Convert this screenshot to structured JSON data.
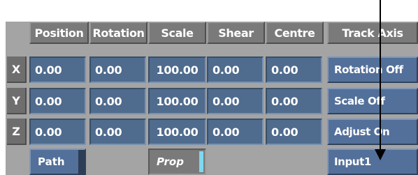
{
  "headers": {
    "position": "Position",
    "rotation": "Rotation",
    "scale": "Scale",
    "shear": "Shear",
    "centre": "Centre",
    "track_axis": "Track Axis"
  },
  "rows": [
    {
      "label": "X",
      "position": "0.00",
      "rotation": "0.00",
      "scale": "100.00",
      "shear": "0.00",
      "centre": "0.00",
      "mode": "Rotation Off"
    },
    {
      "label": "Y",
      "position": "0.00",
      "rotation": "0.00",
      "scale": "100.00",
      "shear": "0.00",
      "centre": "0.00",
      "mode": "Scale Off"
    },
    {
      "label": "Z",
      "position": "0.00",
      "rotation": "0.00",
      "scale": "100.00",
      "shear": "0.00",
      "centre": "0.00",
      "mode": "Adjust On"
    }
  ],
  "bottom": {
    "path": "Path",
    "prop": "Prop",
    "input": "Input1"
  },
  "colors": {
    "panel": "#a4a4a4",
    "field": "#4f6b8d",
    "button": "#53709a",
    "header": "#7a7a7a",
    "prop_indicator": "#7fd8f0"
  }
}
